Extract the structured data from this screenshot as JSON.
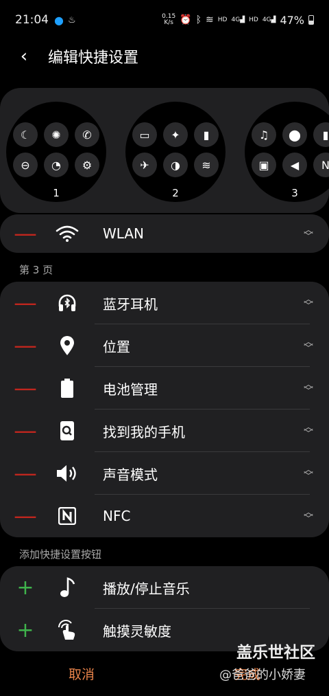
{
  "status_bar": {
    "time": "21:04",
    "net_speed_value": "0.15",
    "net_speed_unit": "K/s",
    "battery_pct": "47%",
    "hd1": "HD",
    "hd2": "HD",
    "sig1": "4G",
    "sig2": "4G"
  },
  "header": {
    "back_icon": "‹",
    "title": "编辑快捷设置"
  },
  "preview": {
    "pages": [
      {
        "number": "1",
        "icons": [
          "☾",
          "✺",
          "✆",
          "⊖",
          "◔",
          "⚙"
        ]
      },
      {
        "number": "2",
        "icons": [
          "▭",
          "✦",
          "▮",
          "✈",
          "◑",
          "≋"
        ]
      },
      {
        "number": "3",
        "icons": [
          "♫",
          "⬤",
          "▮",
          "▣",
          "◀",
          "N"
        ]
      }
    ]
  },
  "wlan_row": {
    "label": "WLAN",
    "icon": "wifi-icon"
  },
  "section_page3": "第 3 页",
  "page3_items": [
    {
      "label": "蓝牙耳机",
      "icon": "bluetooth-headphones-icon"
    },
    {
      "label": "位置",
      "icon": "location-icon"
    },
    {
      "label": "电池管理",
      "icon": "battery-icon"
    },
    {
      "label": "找到我的手机",
      "icon": "find-my-phone-icon"
    },
    {
      "label": "声音模式",
      "icon": "sound-icon"
    },
    {
      "label": "NFC",
      "icon": "nfc-icon"
    }
  ],
  "section_add": "添加快捷设置按钮",
  "add_items": [
    {
      "label": "播放/停止音乐",
      "icon": "music-note-icon"
    },
    {
      "label": "触摸灵敏度",
      "icon": "touch-sensitivity-icon"
    }
  ],
  "bottom": {
    "cancel": "取消",
    "done": "完成"
  },
  "watermark": {
    "line1": "盖乐世社区",
    "line2": "@爸爸的小娇妻"
  }
}
